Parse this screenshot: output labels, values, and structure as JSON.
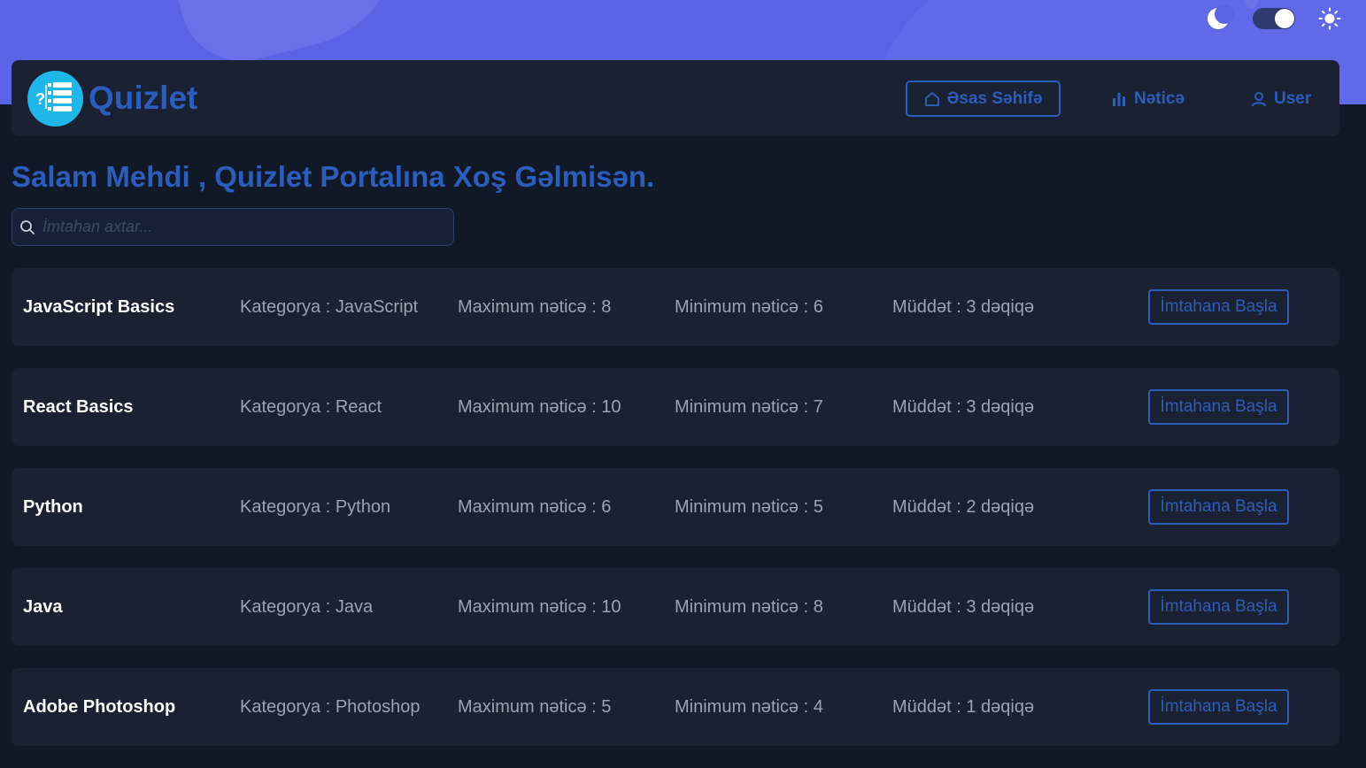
{
  "header": {
    "brand": "Quizlet",
    "nav": {
      "home": "Əsas Səhifə",
      "results": "Nəticə",
      "user": "User"
    },
    "theme": {
      "dark_icon": "moon-icon",
      "light_icon": "sun-icon",
      "toggle_on": true
    }
  },
  "welcome": "Salam Mehdi , Quizlet Portalına Xoş Gəlmisən.",
  "search": {
    "placeholder": "İmtahan axtar..."
  },
  "quizzes": [
    {
      "title": "JavaScript Basics",
      "category": "Kategorya : JavaScript",
      "max": "Maximum nəticə : 8",
      "min": "Minimum nəticə : 6",
      "duration": "Müddət : 3 dəqiqə",
      "button": "İmtahana Başla"
    },
    {
      "title": "React Basics",
      "category": "Kategorya : React",
      "max": "Maximum nəticə : 10",
      "min": "Minimum nəticə : 7",
      "duration": "Müddət : 3 dəqiqə",
      "button": "İmtahana Başla"
    },
    {
      "title": "Python",
      "category": "Kategorya : Python",
      "max": "Maximum nəticə : 6",
      "min": "Minimum nəticə : 5",
      "duration": "Müddət : 2 dəqiqə",
      "button": "İmtahana Başla"
    },
    {
      "title": "Java",
      "category": "Kategorya : Java",
      "max": "Maximum nəticə : 10",
      "min": "Minimum nəticə : 8",
      "duration": "Müddət : 3 dəqiqə",
      "button": "İmtahana Başla"
    },
    {
      "title": "Adobe Photoshop",
      "category": "Kategorya : Photoshop",
      "max": "Maximum nəticə : 5",
      "min": "Minimum nəticə : 4",
      "duration": "Müddət : 1 dəqiqə",
      "button": "İmtahana Başla"
    }
  ],
  "colors": {
    "accent": "#2c5dba",
    "band": "#5a63e3",
    "background": "#111827",
    "card": "#1a2132"
  }
}
